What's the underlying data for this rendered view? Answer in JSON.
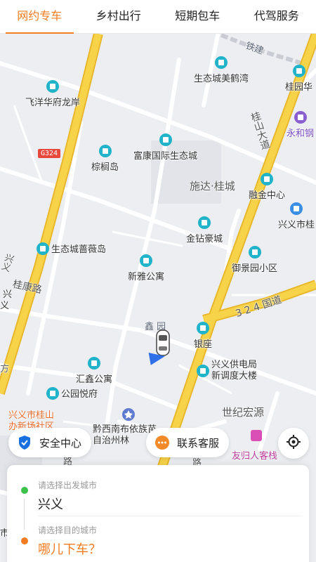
{
  "tabs": [
    {
      "label": "网约专车",
      "active": true
    },
    {
      "label": "乡村出行",
      "active": false
    },
    {
      "label": "短期包车",
      "active": false
    },
    {
      "label": "代驾服务",
      "active": false
    }
  ],
  "map": {
    "pois": {
      "tiejian": "铁建",
      "shengtai_meihewan": "生态城美鹤湾",
      "guiyuan": "桂园华",
      "feiyang": "飞洋华府龙岸",
      "yonghe": "永和钢",
      "fukang": "富康国际生态城",
      "zonglvdao": "棕榈岛",
      "shida": "施达·桂城",
      "rongjin": "融金中心",
      "xingyi_gui": "兴义市桂",
      "jinzuan": "金钻豪城",
      "shengtai_qiangwei": "生态城蔷薇岛",
      "yujingyuan": "御景园小区",
      "xinya": "新雅公寓",
      "xin_yuan": "鑫   园",
      "yinzuo": "银座",
      "gongdian": "兴义供电局",
      "diaodu": "新调度大楼",
      "huixin": "汇鑫公寓",
      "gongyuan": "公园悦府",
      "shiji": "世纪宏源",
      "banshi": "兴义市桂山",
      "banshi2": "办新场社区",
      "qianxinan": "黔西南布依族苗",
      "zizhizhou": "自治州林",
      "youguiren": "友归人客栈",
      "fang": "方",
      "xing": "兴",
      "yi": "义",
      "shi": "市",
      "wen": "文"
    },
    "roads": {
      "g324": "G324",
      "guishan": "桂山大道",
      "guikang": "桂康路",
      "guodao": "3 2 4 国道",
      "xingyi_road": "兴义",
      "lu": "路",
      "lu2": "路"
    },
    "colors": {
      "main_road": "#f7d34a",
      "main_road_edge": "#e8b72c",
      "poi_pin": "#21b3c9",
      "accent": "#f27c22"
    }
  },
  "chips": {
    "safety": {
      "label": "安全中心",
      "icon": "shield-icon"
    },
    "service": {
      "label": "联系客服",
      "icon": "chat-icon"
    },
    "locate": {
      "icon": "locate-icon"
    }
  },
  "card": {
    "origin_hint": "请选择出发城市",
    "origin_value": "兴义",
    "dest_hint": "请选择目的城市",
    "dest_value": "哪儿下车？"
  }
}
